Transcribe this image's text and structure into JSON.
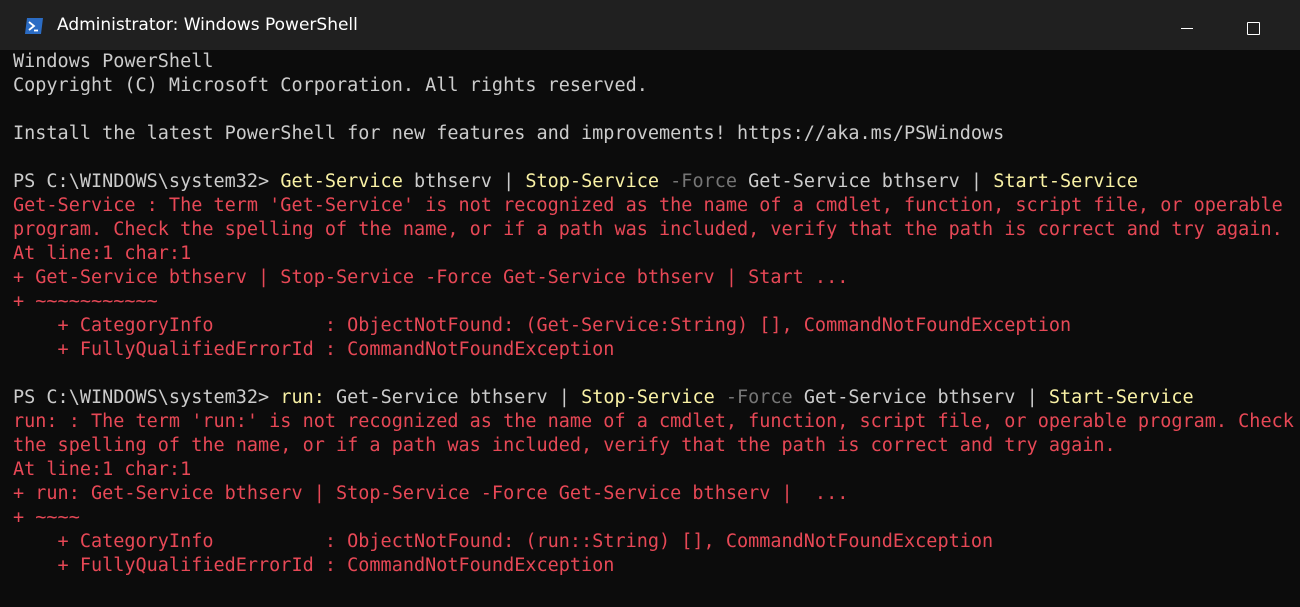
{
  "window": {
    "title": "Administrator: Windows PowerShell",
    "icon": "powershell-icon",
    "controls": [
      "minimize-icon",
      "maximize-icon"
    ]
  },
  "colors": {
    "background": "#0c0c0c",
    "titlebar": "#202020",
    "text": "#cccccc",
    "command": "#f9f1a5",
    "parameter": "#767676",
    "error": "#e74856"
  },
  "console": {
    "lines": [
      {
        "segments": [
          {
            "t": "Windows PowerShell",
            "c": "default"
          }
        ]
      },
      {
        "segments": [
          {
            "t": "Copyright (C) Microsoft Corporation. All rights reserved.",
            "c": "default"
          }
        ]
      },
      {
        "segments": []
      },
      {
        "segments": [
          {
            "t": "Install the latest PowerShell for new features and improvements! https://aka.ms/PSWindows",
            "c": "default"
          }
        ]
      },
      {
        "segments": []
      },
      {
        "segments": [
          {
            "t": "PS C:\\WINDOWS\\system32> ",
            "c": "default"
          },
          {
            "t": "Get-Service",
            "c": "cmd"
          },
          {
            "t": " bthserv | ",
            "c": "default"
          },
          {
            "t": "Stop-Service",
            "c": "cmd"
          },
          {
            "t": " -Force",
            "c": "param"
          },
          {
            "t": " Get-Service bthserv | ",
            "c": "default"
          },
          {
            "t": "Start-Service",
            "c": "cmd"
          }
        ]
      },
      {
        "segments": [
          {
            "t": "Get-Service : The term 'Get-Service' is not recognized as the name of a cmdlet, function, script file, or operable",
            "c": "err"
          }
        ]
      },
      {
        "segments": [
          {
            "t": "program. Check the spelling of the name, or if a path was included, verify that the path is correct and try again.",
            "c": "err"
          }
        ]
      },
      {
        "segments": [
          {
            "t": "At line:1 char:1",
            "c": "err"
          }
        ]
      },
      {
        "segments": [
          {
            "t": "+ Get-Service bthserv | Stop-Service -Force Get-Service bthserv | Start ...",
            "c": "err"
          }
        ]
      },
      {
        "segments": [
          {
            "t": "+ ~~~~~~~~~~~",
            "c": "err"
          }
        ]
      },
      {
        "segments": [
          {
            "t": "    + CategoryInfo          : ObjectNotFound: (Get-Service:String) [], CommandNotFoundException",
            "c": "err"
          }
        ]
      },
      {
        "segments": [
          {
            "t": "    + FullyQualifiedErrorId : CommandNotFoundException",
            "c": "err"
          }
        ]
      },
      {
        "segments": []
      },
      {
        "segments": [
          {
            "t": "PS C:\\WINDOWS\\system32> ",
            "c": "default"
          },
          {
            "t": "run:",
            "c": "cmd"
          },
          {
            "t": " Get-Service bthserv | ",
            "c": "default"
          },
          {
            "t": "Stop-Service",
            "c": "cmd"
          },
          {
            "t": " -Force",
            "c": "param"
          },
          {
            "t": " Get-Service bthserv | ",
            "c": "default"
          },
          {
            "t": "Start-Service",
            "c": "cmd"
          }
        ]
      },
      {
        "segments": [
          {
            "t": "run: : The term 'run:' is not recognized as the name of a cmdlet, function, script file, or operable program. Check",
            "c": "err"
          }
        ]
      },
      {
        "segments": [
          {
            "t": "the spelling of the name, or if a path was included, verify that the path is correct and try again.",
            "c": "err"
          }
        ]
      },
      {
        "segments": [
          {
            "t": "At line:1 char:1",
            "c": "err"
          }
        ]
      },
      {
        "segments": [
          {
            "t": "+ run: Get-Service bthserv | Stop-Service -Force Get-Service bthserv |  ...",
            "c": "err"
          }
        ]
      },
      {
        "segments": [
          {
            "t": "+ ~~~~",
            "c": "err"
          }
        ]
      },
      {
        "segments": [
          {
            "t": "    + CategoryInfo          : ObjectNotFound: (run::String) [], CommandNotFoundException",
            "c": "err"
          }
        ]
      },
      {
        "segments": [
          {
            "t": "    + FullyQualifiedErrorId : CommandNotFoundException",
            "c": "err"
          }
        ]
      }
    ]
  }
}
